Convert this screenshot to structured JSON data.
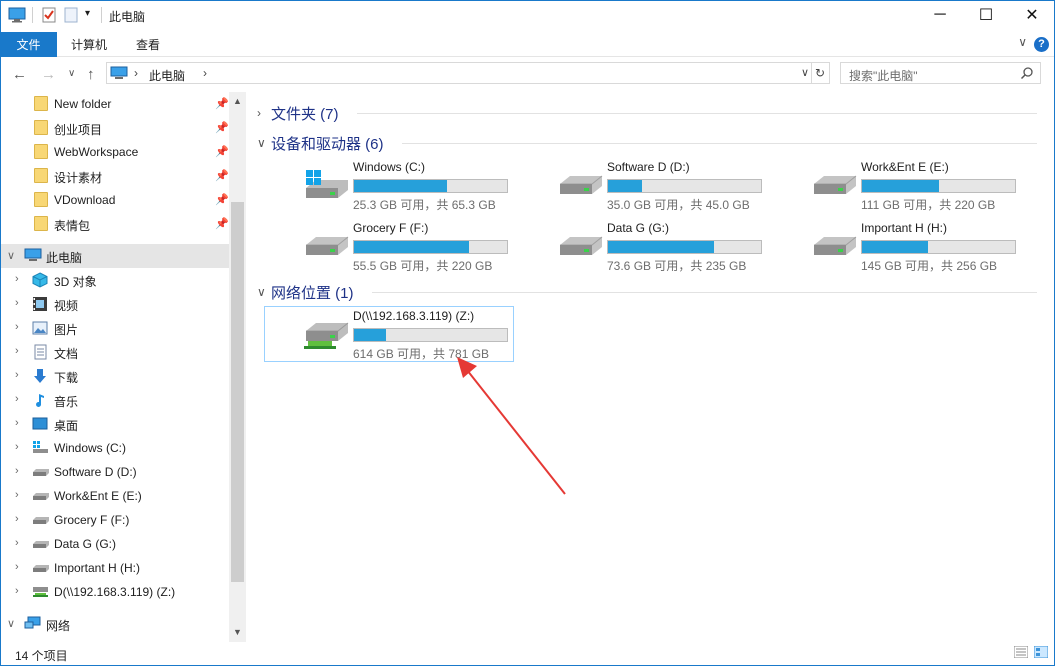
{
  "window": {
    "title": "此电脑",
    "controls": {
      "minimize": "─",
      "maximize": "☐",
      "close": "✕"
    }
  },
  "ribbon": {
    "tabs": [
      "文件",
      "计算机",
      "查看"
    ]
  },
  "address": {
    "path": "此电脑",
    "search_placeholder": "搜索\"此电脑\""
  },
  "nav": {
    "quick_access": [
      {
        "label": "New folder"
      },
      {
        "label": "创业项目"
      },
      {
        "label": "WebWorkspace"
      },
      {
        "label": "设计素材"
      },
      {
        "label": "VDownload"
      },
      {
        "label": "表情包"
      }
    ],
    "this_pc": {
      "label": "此电脑"
    },
    "this_pc_children": [
      {
        "label": "3D 对象",
        "icon": "3d-objects-icon"
      },
      {
        "label": "视频",
        "icon": "videos-icon"
      },
      {
        "label": "图片",
        "icon": "pictures-icon"
      },
      {
        "label": "文档",
        "icon": "documents-icon"
      },
      {
        "label": "下载",
        "icon": "downloads-icon"
      },
      {
        "label": "音乐",
        "icon": "music-icon"
      },
      {
        "label": "桌面",
        "icon": "desktop-icon"
      },
      {
        "label": "Windows (C:)",
        "icon": "windows-drive-icon"
      },
      {
        "label": "Software D (D:)",
        "icon": "drive-icon"
      },
      {
        "label": "Work&Ent E (E:)",
        "icon": "drive-icon"
      },
      {
        "label": "Grocery F (F:)",
        "icon": "drive-icon"
      },
      {
        "label": "Data G (G:)",
        "icon": "drive-icon"
      },
      {
        "label": "Important H (H:)",
        "icon": "drive-icon"
      },
      {
        "label": "D(\\\\192.168.3.119) (Z:)",
        "icon": "network-drive-icon"
      }
    ],
    "network": {
      "label": "网络"
    }
  },
  "groups": {
    "folders": {
      "title": "文件夹 (7)"
    },
    "devices": {
      "title": "设备和驱动器 (6)"
    },
    "network": {
      "title": "网络位置 (1)"
    }
  },
  "drives": [
    {
      "name": "Windows (C:)",
      "info": "25.3 GB 可用，共 65.3 GB",
      "used_fraction": 0.61,
      "icon": "windows-drive-icon"
    },
    {
      "name": "Software D (D:)",
      "info": "35.0 GB 可用，共 45.0 GB",
      "used_fraction": 0.22,
      "icon": "drive-icon"
    },
    {
      "name": "Work&Ent E (E:)",
      "info": "111 GB 可用，共 220 GB",
      "used_fraction": 0.5,
      "icon": "drive-icon"
    },
    {
      "name": "Grocery F (F:)",
      "info": "55.5 GB 可用，共 220 GB",
      "used_fraction": 0.75,
      "icon": "drive-icon"
    },
    {
      "name": "Data G (G:)",
      "info": "73.6 GB 可用，共 235 GB",
      "used_fraction": 0.69,
      "icon": "drive-icon"
    },
    {
      "name": "Important H (H:)",
      "info": "145 GB 可用，共 256 GB",
      "used_fraction": 0.43,
      "icon": "drive-icon"
    }
  ],
  "network_drive": {
    "name": "D(\\\\192.168.3.119) (Z:)",
    "info": "614 GB 可用，共 781 GB",
    "used_fraction": 0.21,
    "icon": "network-drive-icon"
  },
  "status": {
    "item_count": "14 个项目"
  },
  "colors": {
    "accent": "#1979ca",
    "bar_fill": "#26a0da",
    "annotation_arrow": "#e53935"
  }
}
